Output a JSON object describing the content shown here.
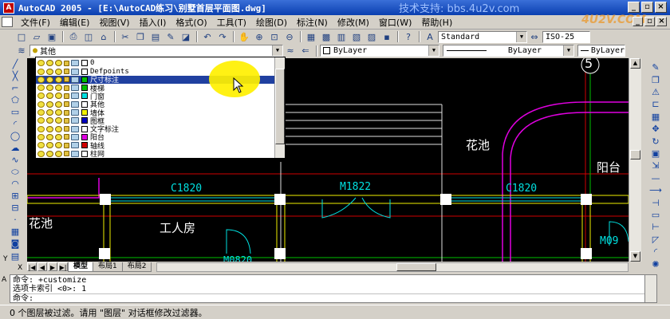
{
  "window": {
    "app_icon_label": "A",
    "title": "AutoCAD 2005 - [E:\\AutoCAD练习\\别墅首层平面图.dwg]",
    "watermark": "技术支持: bbs.4u2v.com",
    "watermark_logo": "4U2V.COM"
  },
  "menu": {
    "items": [
      "文件(F)",
      "编辑(E)",
      "视图(V)",
      "插入(I)",
      "格式(O)",
      "工具(T)",
      "绘图(D)",
      "标注(N)",
      "修改(M)",
      "窗口(W)",
      "帮助(H)"
    ]
  },
  "toolbar1": {
    "text_style": "Standard",
    "dim_style": "ISO-25"
  },
  "toolbar2": {
    "current_layer": "其他",
    "color": "ByLayer",
    "linetype": "ByLayer",
    "lineweight": "ByLayer"
  },
  "layer_dropdown": {
    "layers": [
      {
        "name": "0",
        "color": "#ffffff",
        "selected": false
      },
      {
        "name": "Defpoints",
        "color": "#ffffff",
        "selected": false
      },
      {
        "name": "尺寸标注",
        "color": "#00c000",
        "selected": true
      },
      {
        "name": "楼梯",
        "color": "#00c000",
        "selected": false
      },
      {
        "name": "门窗",
        "color": "#00e0e0",
        "selected": false
      },
      {
        "name": "其他",
        "color": "#ffffff",
        "selected": false
      },
      {
        "name": "墙体",
        "color": "#f0f000",
        "selected": false
      },
      {
        "name": "图框",
        "color": "#0000c0",
        "selected": false
      },
      {
        "name": "文字标注",
        "color": "#ffffff",
        "selected": false
      },
      {
        "name": "阳台",
        "color": "#e000e0",
        "selected": false
      },
      {
        "name": "轴线",
        "color": "#d00000",
        "selected": false
      },
      {
        "name": "柱网",
        "color": "#ffffff",
        "selected": false
      }
    ]
  },
  "drawing": {
    "axis_bubble": "5",
    "labels": {
      "flower_pool_right": "花池",
      "balcony": "阳台",
      "window_c1820_left": "C1820",
      "door_m1822": "M1822",
      "window_c1820_right": "C1820",
      "flower_pool_left": "花池",
      "workers_room": "工人房",
      "door_m09": "M09",
      "door_m0820": "M0820"
    }
  },
  "tabs": {
    "items": [
      "模型",
      "布局1",
      "布局2"
    ]
  },
  "ucs": {
    "y": "Y",
    "x": "X"
  },
  "command": {
    "line1": "命令:  +customize",
    "line2": "选项卡索引 <0>:  1",
    "line3": "命令:",
    "letter": "A"
  },
  "status": {
    "text": "0 个图层被过滤。请用 \"图层\" 对话框修改过滤器。"
  }
}
